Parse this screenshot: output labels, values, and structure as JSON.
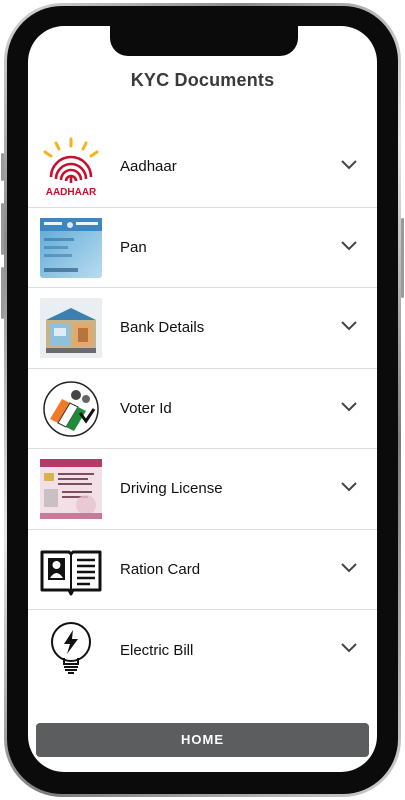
{
  "header": {
    "title": "KYC Documents"
  },
  "documents": [
    {
      "label": "Aadhaar",
      "icon": "aadhaar-logo-icon",
      "thumb_text": "AADHAAR"
    },
    {
      "label": "Pan",
      "icon": "pan-card-icon",
      "thumb_text": ""
    },
    {
      "label": "Bank Details",
      "icon": "bank-building-icon",
      "thumb_text": ""
    },
    {
      "label": "Voter Id",
      "icon": "election-commission-icon",
      "thumb_text": ""
    },
    {
      "label": "Driving License",
      "icon": "driving-license-card-icon",
      "thumb_text": ""
    },
    {
      "label": "Ration Card",
      "icon": "ration-card-book-icon",
      "thumb_text": ""
    },
    {
      "label": "Electric Bill",
      "icon": "light-bulb-icon",
      "thumb_text": ""
    }
  ],
  "footer": {
    "home_label": "HOME"
  },
  "colors": {
    "title": "#3a3a3a",
    "home_button": "#5c5d5f",
    "divider": "#dedede",
    "aadhaar_red": "#c8102e",
    "aadhaar_sun": "#f7b21a"
  }
}
